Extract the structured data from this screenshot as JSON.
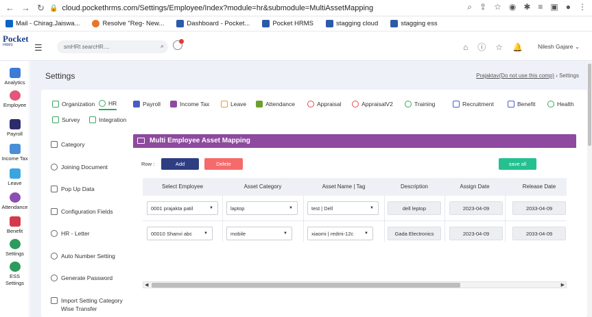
{
  "browser": {
    "url": "cloud.pockethrms.com/Settings/Employee/Index?module=hr&submodule=MultiAssetMapping",
    "bookmarks": [
      "Mail - Chirag.Jaiswa...",
      "Resolve \"Reg- New...",
      "Dashboard - Pocket...",
      "Pocket HRMS",
      "stagging cloud",
      "stagging ess"
    ]
  },
  "header": {
    "logo_top": "Pocket",
    "logo_bottom": "HRMS",
    "search_placeholder": "smHRt searcHR....",
    "user_name": "Nilesh Gajare"
  },
  "sidebar": {
    "items": [
      "Analytics",
      "Employee",
      "Payroll",
      "Income Tax",
      "Leave",
      "Attendance",
      "Benefit",
      "Settings",
      "ESS Settings"
    ]
  },
  "page": {
    "title": "Settings",
    "breadcrumb_link": "Prajaktav(Do not use this comp)",
    "breadcrumb_sep": "›",
    "breadcrumb_current": "Settings"
  },
  "tabs": [
    "Organization",
    "HR",
    "Payroll",
    "Income Tax",
    "Leave",
    "Attendance",
    "Appraisal",
    "AppraisalV2",
    "Training",
    "Recruitment",
    "Benefit",
    "Health",
    "Survey",
    "Integration"
  ],
  "left_menu": [
    "Category",
    "Joining Document",
    "Pop Up Data",
    "Configuration Fields",
    "HR - Letter",
    "Auto Number Setting",
    "Generate Password",
    "Import Setting Category Wise Transfer"
  ],
  "panel": {
    "title": "Multi Employee Asset Mapping",
    "row_label": "Row :",
    "add_label": "Add",
    "delete_label": "Delete",
    "save_label": "save all",
    "columns": [
      "Select Employee",
      "Asset Category",
      "Asset Name | Tag",
      "Description",
      "Assign Date",
      "Release Date"
    ],
    "rows": [
      {
        "employee": "0001 prajakta patil",
        "category": "laptop",
        "asset": "test | Dell",
        "description": "dell leptop",
        "assign": "2023-04-09",
        "release": "2033-04-09"
      },
      {
        "employee": "00010 Shanvi abc",
        "category": "mobile",
        "asset": "xiaomi | redmi-12c",
        "description": "Gada Electronics",
        "assign": "2023-04-09",
        "release": "2033-04-09"
      }
    ]
  }
}
